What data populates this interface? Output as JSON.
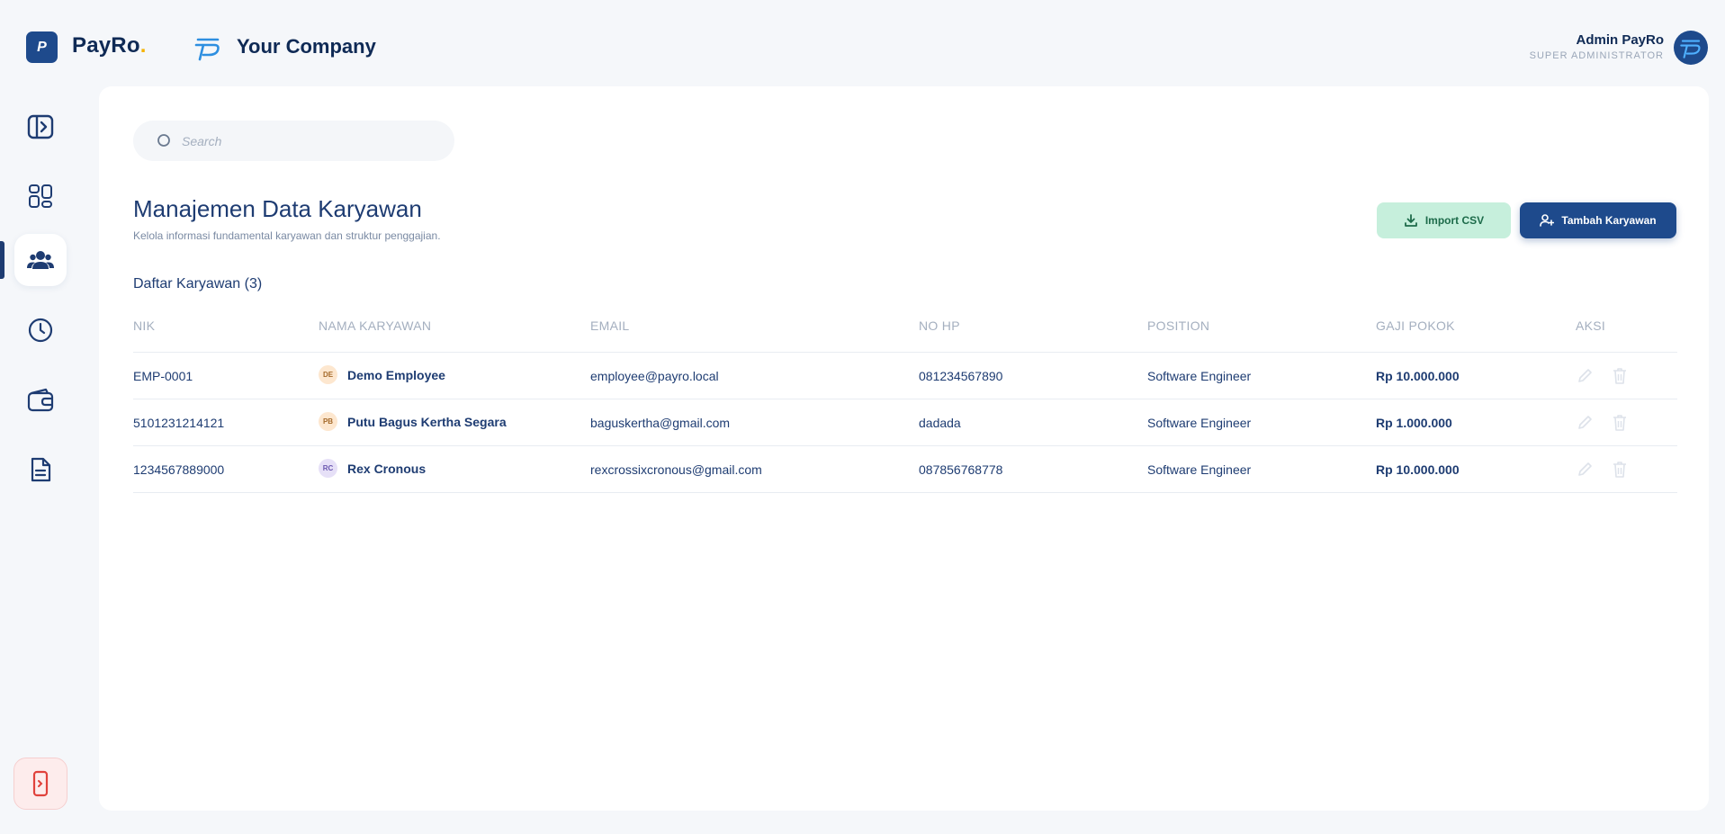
{
  "brand": {
    "logo_letter": "P",
    "name": "PayRo",
    "dot": "."
  },
  "company": {
    "name": "Your Company"
  },
  "user": {
    "name": "Admin PayRo",
    "role": "SUPER ADMINISTRATOR"
  },
  "sidebar": {
    "items": [
      {
        "icon": "sidebar-toggle-icon",
        "active": false
      },
      {
        "icon": "dashboard-icon",
        "active": false
      },
      {
        "icon": "users-icon",
        "active": true
      },
      {
        "icon": "clock-icon",
        "active": false
      },
      {
        "icon": "wallet-icon",
        "active": false
      },
      {
        "icon": "document-icon",
        "active": false
      }
    ],
    "logout_icon": "logout-icon"
  },
  "search": {
    "placeholder": "Search",
    "value": ""
  },
  "page": {
    "title": "Manajemen Data Karyawan",
    "subtitle": "Kelola informasi fundamental karyawan dan struktur penggajian."
  },
  "actions": {
    "import_label": "Import CSV",
    "add_label": "Tambah Karyawan"
  },
  "list": {
    "title": "Daftar Karyawan",
    "count": "(3)"
  },
  "table": {
    "headers": [
      "NIK",
      "NAMA KARYAWAN",
      "EMAIL",
      "NO HP",
      "POSITION",
      "GAJI POKOK",
      "AKSI"
    ],
    "rows": [
      {
        "nik": "EMP-0001",
        "initials": "DE",
        "name": "Demo Employee",
        "email": "employee@payro.local",
        "phone": "081234567890",
        "position": "Software Engineer",
        "salary": "Rp 10.000.000",
        "avatar_bg": "#fde7cf",
        "avatar_fg": "#a56a2b"
      },
      {
        "nik": "5101231214121",
        "initials": "PB",
        "name": "Putu Bagus Kertha Segara",
        "email": "baguskertha@gmail.com",
        "phone": "dadada",
        "position": "Software Engineer",
        "salary": "Rp 1.000.000",
        "avatar_bg": "#fde7cf",
        "avatar_fg": "#a56a2b"
      },
      {
        "nik": "1234567889000",
        "initials": "RC",
        "name": "Rex Cronous",
        "email": "rexcrossixcronous@gmail.com",
        "phone": "087856768778",
        "position": "Software Engineer",
        "salary": "Rp 10.000.000",
        "avatar_bg": "#e6e0f7",
        "avatar_fg": "#6b58b0"
      }
    ]
  },
  "colors": {
    "primary": "#1e4a8c",
    "accent": "#f5b301",
    "import_bg": "#c6efdc",
    "logout_bg": "#fdecec"
  }
}
